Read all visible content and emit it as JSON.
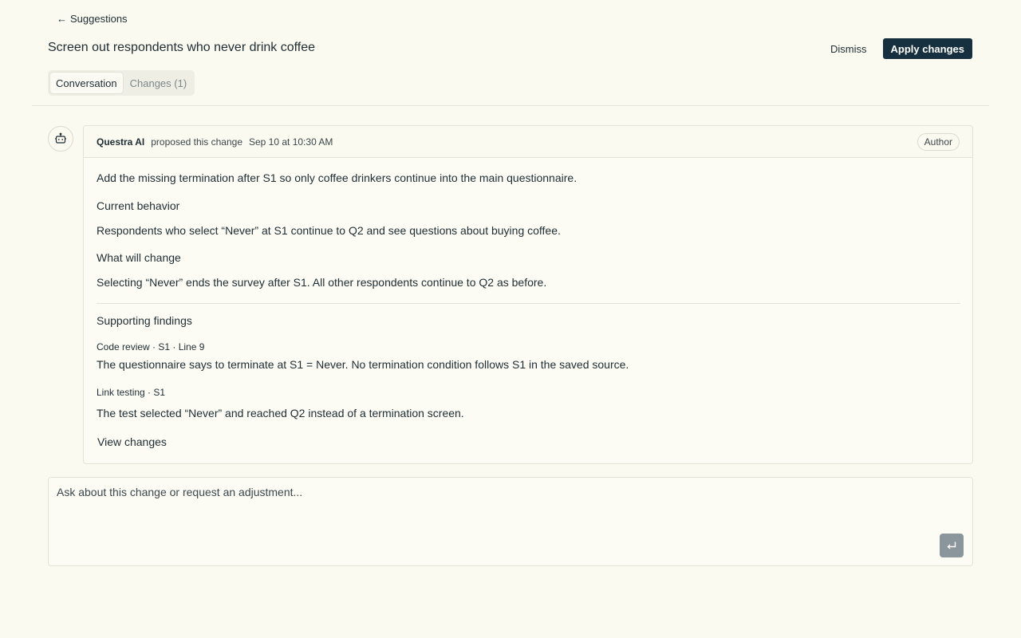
{
  "nav": {
    "back_label": "Suggestions",
    "back_arrow": "←"
  },
  "header": {
    "title": "Screen out respondents who never drink coffee",
    "dismiss_label": "Dismiss",
    "apply_label": "Apply changes"
  },
  "tabs": [
    {
      "label": "Conversation",
      "active": true
    },
    {
      "label": "Changes (1)",
      "active": false
    }
  ],
  "message": {
    "avatar_icon": "robot-icon",
    "author": "Questra AI",
    "action": "proposed this change",
    "timestamp": "Sep 10 at 10:30 AM",
    "badge": "Author",
    "summary": "Add the missing termination after S1 so only coffee drinkers continue into the main questionnaire.",
    "current_heading": "Current behavior",
    "current_text": "Respondents who select “Never” at S1 continue to Q2 and see questions about buying coffee.",
    "change_heading": "What will change",
    "change_text": "Selecting “Never” ends the survey after S1. All other respondents continue to Q2 as before.",
    "findings_heading": "Supporting findings",
    "findings": [
      {
        "label": "Code review · S1 · Line 9",
        "text": "The questionnaire says to terminate at S1 = Never. No termination condition follows S1 in the saved source."
      },
      {
        "label": "Link testing · S1",
        "text": "The test selected “Never” and reached Q2 instead of a termination screen."
      }
    ],
    "view_changes_label": "View changes"
  },
  "composer": {
    "placeholder": "Ask about this change or request an adjustment...",
    "value": "",
    "send_icon": "return-icon"
  },
  "colors": {
    "background": "#fafaf0",
    "primary_button": "#17303f",
    "send_button": "#8a969b"
  }
}
